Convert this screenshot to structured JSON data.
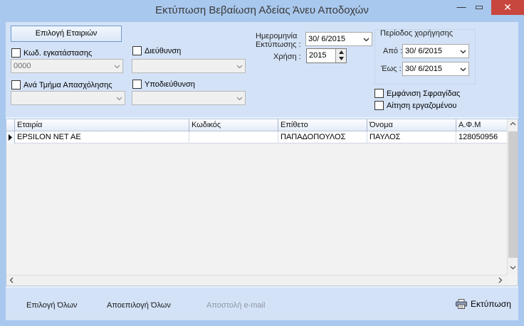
{
  "window": {
    "title": "Εκτύπωση Βεβαίωση Αδείας Άνευ Αποδοχών",
    "min_glyph": "—",
    "max_glyph": "▭",
    "close_glyph": "✕"
  },
  "filters": {
    "companies_button": "Επιλογή Εταιριών",
    "install_code": {
      "label": "Κωδ. εγκατάστασης",
      "value": "0000"
    },
    "address": {
      "label": "Διεύθυνση",
      "value": ""
    },
    "department": {
      "label": "Ανά Τμήμα Απασχόλησης",
      "value": ""
    },
    "subaddress": {
      "label": "Υποδιεύθυνση",
      "value": ""
    },
    "print_date": {
      "label": "Ημερομηνία Εκτύπωσης :",
      "value": "30/ 6/2015"
    },
    "year": {
      "label": "Χρήση :",
      "value": "2015"
    },
    "period": {
      "label": "Περίοδος χορήγησης",
      "from_label": "Από :",
      "from_value": "30/ 6/2015",
      "to_label": "Έως :",
      "to_value": "30/ 6/2015"
    },
    "show_stamp": {
      "label": "Εμφάνιση Σφραγίδας",
      "checked": false
    },
    "employee_request": {
      "label": "Αίτηση εργαζομένου",
      "checked": false
    }
  },
  "grid": {
    "columns": [
      "Εταιρία",
      "Κωδικός",
      "Επίθετο",
      "Όνομα",
      "Α.Φ.Μ"
    ],
    "rows": [
      {
        "company": "EPSILON NET AE",
        "code": "",
        "surname": "ΠΑΠΑΔΟΠΟΥΛΟΣ",
        "name": "ΠΑΥΛΟΣ",
        "afm": "128050956"
      }
    ]
  },
  "footer": {
    "select_all": "Επιλογή Όλων",
    "deselect_all": "Αποεπιλογή Όλων",
    "send_email": "Αποστολή e-mail",
    "print": "Εκτύπωση"
  }
}
